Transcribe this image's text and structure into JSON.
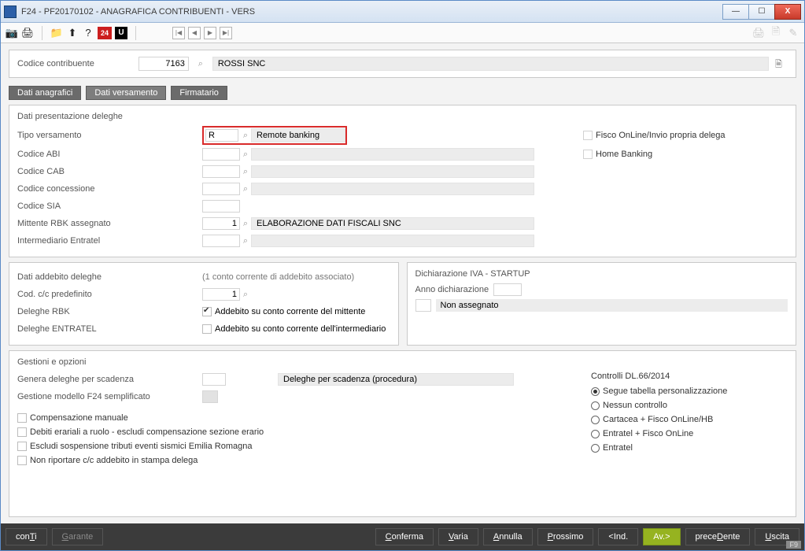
{
  "window": {
    "title": "F24  - PF20170102  -  ANAGRAFICA CONTRIBUENTI - VERS"
  },
  "toolbar": {
    "icons": {
      "camera": "📷",
      "print": "🖨",
      "folder": "📁",
      "upload": "⬆",
      "help": "?",
      "twentyfour": "24",
      "u": "U"
    },
    "nav": {
      "first": "|◀",
      "prev": "◀",
      "next": "▶",
      "last": "▶|"
    },
    "right": {
      "print2": "🖨",
      "doc": "🗎",
      "edit": "✎"
    }
  },
  "toprow": {
    "label": "Codice contribuente",
    "code": "7163",
    "name": "ROSSI SNC"
  },
  "tabs": {
    "anag": "Dati anagrafici",
    "vers": "Dati versamento",
    "firm": "Firmatario"
  },
  "panel1": {
    "title": "Dati presentazione deleghe",
    "tipo_label": "Tipo versamento",
    "tipo_code": "R",
    "tipo_desc": "Remote banking",
    "abi_label": "Codice ABI",
    "cab_label": "Codice CAB",
    "conc_label": "Codice concessione",
    "sia_label": "Codice SIA",
    "rbk_label": "Mittente RBK assegnato",
    "rbk_code": "1",
    "rbk_desc": "ELABORAZIONE DATI FISCALI SNC",
    "entratel_label": "Intermediario Entratel",
    "side_fisco": "Fisco OnLine/Invio propria delega",
    "side_home": "Home Banking"
  },
  "panel2": {
    "title": "Dati addebito deleghe",
    "note": "(1 conto corrente di addebito associato)",
    "cc_label": "Cod. c/c predefinito",
    "cc_code": "1",
    "rbk_label": "Deleghe RBK",
    "rbk_chk": "Addebito su conto corrente del mittente",
    "ent_label": "Deleghe ENTRATEL",
    "ent_chk": "Addebito su conto corrente dell'intermediario",
    "iva_title": "Dichiarazione IVA - STARTUP",
    "anno_label": "Anno dichiarazione",
    "non_assegnato": "Non assegnato"
  },
  "panel3": {
    "title": "Gestioni e opzioni",
    "gen_label": "Genera deleghe per scadenza",
    "gen_desc": "Deleghe per scadenza (procedura)",
    "f24s_label": "Gestione modello F24 semplificato",
    "chk1": "Compensazione manuale",
    "chk2": "Debiti erariali a ruolo - escludi compensazione sezione erario",
    "chk3": "Escludi sospensione tributi eventi sismici Emilia Romagna",
    "chk4": "Non riportare c/c addebito in stampa delega",
    "dl_title": "Controlli DL.66/2014",
    "opt1": "Segue tabella personalizzazione",
    "opt2": "Nessun controllo",
    "opt3": "Cartacea + Fisco OnLine/HB",
    "opt4": "Entratel + Fisco OnLine",
    "opt5": "Entratel"
  },
  "footer": {
    "conti": "conTi",
    "garante": "Garante",
    "conferma": "Conferma",
    "varia": "Varia",
    "annulla": "Annulla",
    "prossimo": "Prossimo",
    "ind": "<Ind.",
    "av": "Av.>",
    "precedente": "preceDente",
    "uscita": "Uscita",
    "f9": "F9"
  }
}
